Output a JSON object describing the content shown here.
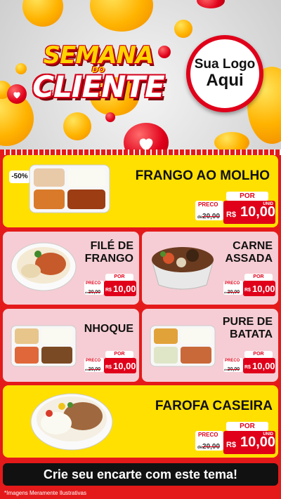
{
  "header": {
    "title_line1": "SEMANA",
    "title_line2": "DO",
    "title_line3": "CLIENTE",
    "logo_line1": "Sua Logo",
    "logo_line2": "Aqui"
  },
  "discount_badge": "-50%",
  "price_labels": {
    "preco": "PRECO",
    "por": "POR",
    "currency": "R$",
    "unit": "UNID",
    "old_price": "20,00",
    "old_prefix": "de",
    "new_price": "10,00"
  },
  "products": [
    {
      "name": "FRANGO AO MOLHO"
    },
    {
      "name_line1": "FILÉ DE",
      "name_line2": "FRANGO"
    },
    {
      "name_line1": "CARNE",
      "name_line2": "ASSADA"
    },
    {
      "name": "NHOQUE"
    },
    {
      "name_line1": "PURE DE",
      "name_line2": "BATATA"
    },
    {
      "name": "FAROFA CASEIRA"
    }
  ],
  "footer": {
    "cta": "Crie seu encarte com este tema!",
    "disclaimer": "*Imagens Meramente Ilustrativas"
  },
  "colors": {
    "red": "#e41a1a",
    "yellow": "#ffe000",
    "pink": "#f6cdd4"
  }
}
